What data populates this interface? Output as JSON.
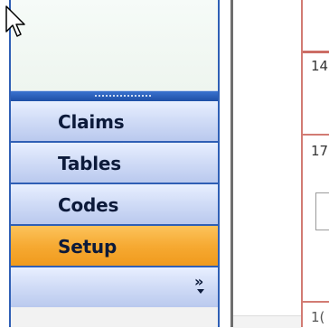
{
  "navigation": {
    "buttons": [
      {
        "label": "Claims",
        "selected": false
      },
      {
        "label": "Tables",
        "selected": false
      },
      {
        "label": "Codes",
        "selected": false
      },
      {
        "label": "Setup",
        "selected": true
      }
    ],
    "more_glyph": "»"
  },
  "calendar": {
    "row_numbers": [
      "14",
      "17",
      "1("
    ]
  },
  "colors": {
    "nav_border": "#2f5fb5",
    "selected_button": "#f6aa33",
    "unselected_button": "#d2ddf7",
    "grid_line": "#d27b73"
  },
  "icons": [
    "mouse-pointer-icon",
    "chevrons-right-icon",
    "caret-down-icon"
  ]
}
